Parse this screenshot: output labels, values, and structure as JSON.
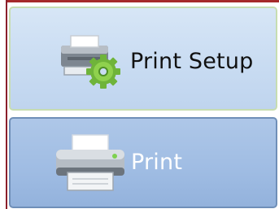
{
  "buttons": {
    "print_setup": {
      "label": "Print Setup",
      "icon": "printer-gear-icon"
    },
    "print": {
      "label": "Print",
      "icon": "printer-icon"
    }
  },
  "colors": {
    "setup_bg": "#c9dcf2",
    "print_bg": "#9fbce3",
    "accent_border": "#8b1f2b"
  }
}
